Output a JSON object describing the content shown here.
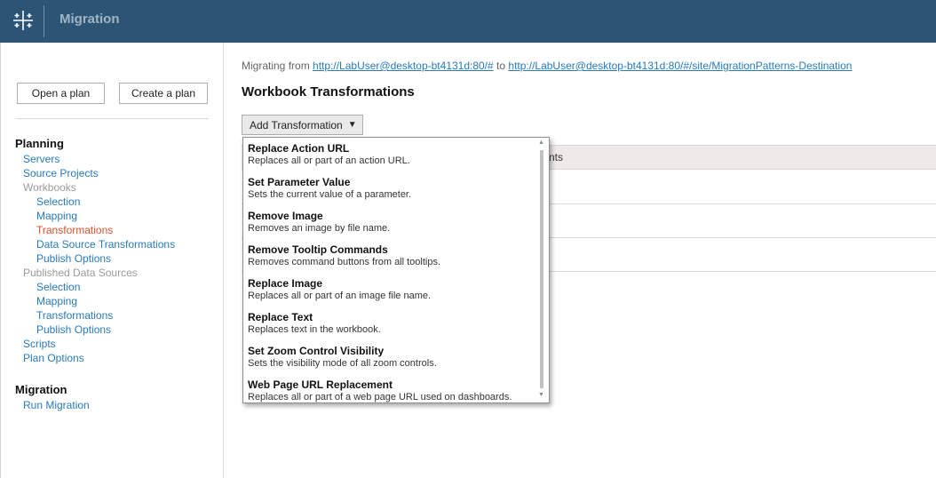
{
  "header": {
    "title": "Migration",
    "logo_icon": "tableau-logo-icon"
  },
  "sidebar": {
    "open_plan_label": "Open a plan",
    "create_plan_label": "Create a plan",
    "planning_heading": "Planning",
    "items": {
      "servers": "Servers",
      "source_projects": "Source Projects",
      "workbooks": "Workbooks",
      "wb_selection": "Selection",
      "wb_mapping": "Mapping",
      "wb_transformations": "Transformations",
      "wb_data_source_transformations": "Data Source Transformations",
      "wb_publish_options": "Publish Options",
      "published_data_sources": "Published Data Sources",
      "pds_selection": "Selection",
      "pds_mapping": "Mapping",
      "pds_transformations": "Transformations",
      "pds_publish_options": "Publish Options",
      "scripts": "Scripts",
      "plan_options": "Plan Options"
    },
    "migration_heading": "Migration",
    "run_migration": "Run Migration"
  },
  "main": {
    "migrating_from_label": "Migrating from",
    "source_url": "http://LabUser@desktop-bt4131d:80/#",
    "to_label": "to",
    "destination_url": "http://LabUser@desktop-bt4131d:80/#/site/MigrationPatterns-Destination",
    "page_title": "Workbook Transformations",
    "add_transformation_label": "Add Transformation",
    "grid_header_partial": "nts"
  },
  "dropdown": {
    "items": [
      {
        "title": "Replace Action URL",
        "desc": "Replaces all or part of an action URL."
      },
      {
        "title": "Set Parameter Value",
        "desc": "Sets the current value of a parameter."
      },
      {
        "title": "Remove Image",
        "desc": "Removes an image by file name."
      },
      {
        "title": "Remove Tooltip Commands",
        "desc": "Removes command buttons from all tooltips."
      },
      {
        "title": "Replace Image",
        "desc": "Replaces all or part of an image file name."
      },
      {
        "title": "Replace Text",
        "desc": "Replaces text in the workbook."
      },
      {
        "title": "Set Zoom Control Visibility",
        "desc": "Sets the visibility mode of all zoom controls."
      },
      {
        "title": "Web Page URL Replacement",
        "desc": "Replaces all or part of a web page URL used on dashboards."
      }
    ]
  },
  "colors": {
    "header_bg": "#2c5575",
    "link": "#2a7ab8",
    "active_nav": "#d9532b",
    "disabled_nav": "#9b9b9b"
  }
}
